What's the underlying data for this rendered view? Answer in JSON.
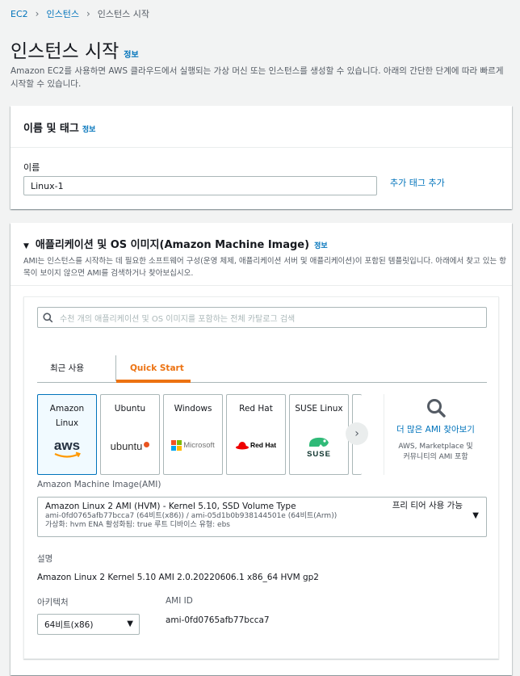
{
  "breadcrumb": {
    "items": [
      "EC2",
      "인스턴스",
      "인스턴스 시작"
    ]
  },
  "page": {
    "title": "인스턴스 시작",
    "info": "정보",
    "description": "Amazon EC2를 사용하면 AWS 클라우드에서 실행되는 가상 머신 또는 인스턴스를 생성할 수 있습니다. 아래의 간단한 단계에 따라 빠르게 시작할 수 있습니다."
  },
  "name_section": {
    "title": "이름 및 태그",
    "info": "정보",
    "name_label": "이름",
    "name_value": "Linux-1",
    "add_tag": "추가 태그 추가"
  },
  "ami_section": {
    "title": "애플리케이션 및 OS 이미지(Amazon Machine Image)",
    "info": "정보",
    "description": "AMI는 인스턴스를 시작하는 데 필요한 소프트웨어 구성(운영 체제, 애플리케이션 서버 및 애플리케이션)이 포함된 템플릿입니다. 아래에서 찾고 있는 항목이 보이지 않으면 AMI를 검색하거나 찾아보십시오.",
    "search_placeholder": "수천 개의 애플리케이션 및 OS 이미지를 포함하는 전체 카탈로그 검색",
    "tabs": [
      "최근 사용",
      "Quick Start"
    ],
    "selected_tab": "Quick Start",
    "tiles": [
      {
        "name": "Amazon Linux",
        "logo": "aws-logo",
        "selected": true
      },
      {
        "name": "Ubuntu",
        "logo": "ubuntu-logo",
        "selected": false
      },
      {
        "name": "Windows",
        "logo": "microsoft-logo",
        "selected": false
      },
      {
        "name": "Red Hat",
        "logo": "redhat-logo",
        "selected": false
      },
      {
        "name": "SUSE Linux",
        "logo": "suse-logo",
        "selected": false
      }
    ],
    "logo_text": {
      "aws": "aws",
      "ubuntu": "ubuntu",
      "microsoft": "Microsoft",
      "redhat": "Red Hat",
      "suse": "SUSE"
    },
    "more_ami_link": "더 많은 AMI 찾아보기",
    "more_ami_sub": "AWS, Marketplace 및 커뮤니티의 AMI 포함",
    "ami_label": "Amazon Machine Image(AMI)",
    "ami_title": "Amazon Linux 2 AMI (HVM) - Kernel 5.10, SSD Volume Type",
    "ami_ids": "ami-0fd0765afb77bcca7 (64비트(x86)) / ami-05d1b0b938144501e (64비트(Arm))",
    "ami_meta": "가상화: hvm     ENA 활성화됨: true     루트 디바이스 유형: ebs",
    "free_tier": "프리 티어 사용 가능",
    "desc_label": "설명",
    "desc_value": "Amazon Linux 2 Kernel 5.10 AMI 2.0.20220606.1 x86_64 HVM gp2",
    "arch_label": "아키텍처",
    "arch_value": "64비트(x86)",
    "ami_id_label": "AMI ID",
    "ami_id_value": "ami-0fd0765afb77bcca7"
  },
  "colors": {
    "link": "#0073bb",
    "accent": "#ec7211",
    "text": "#16191f",
    "muted": "#545b64",
    "background": "#f2f3f3"
  }
}
